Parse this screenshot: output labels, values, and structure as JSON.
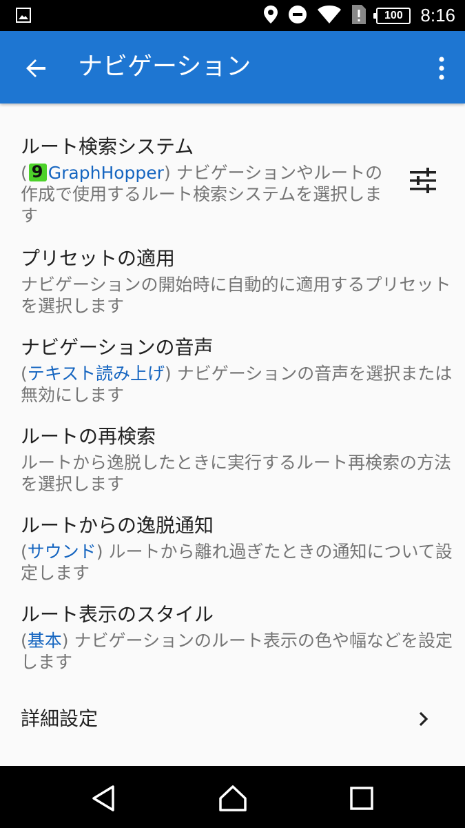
{
  "status_bar": {
    "battery": "100",
    "time": "8:16",
    "icons": [
      "image-icon",
      "location-icon",
      "do-not-disturb-icon",
      "wifi-icon",
      "sim-alert-icon",
      "battery-icon"
    ]
  },
  "app_bar": {
    "title": "ナビゲーション",
    "back_icon": "arrow-left-icon",
    "menu_icon": "more-vert-icon",
    "color": "#1e76d2"
  },
  "prefs": {
    "route_engine": {
      "title": "ルート検索システム",
      "engine": "GraphHopper",
      "summary": "ナビゲーションやルートの作成で使用するルート検索システムを選択します"
    },
    "preset": {
      "title": "プリセットの適用",
      "summary": "ナビゲーションの開始時に自動的に適用するプリセットを選択します"
    },
    "voice": {
      "title": "ナビゲーションの音声",
      "value": "テキスト読み上げ",
      "summary": "ナビゲーションの音声を選択または無効にします"
    },
    "recalc": {
      "title": "ルートの再検索",
      "summary": "ルートから逸脱したときに実行するルート再検索の方法を選択します"
    },
    "deviation": {
      "title": "ルートからの逸脱通知",
      "value": "サウンド",
      "summary": "ルートから離れ過ぎたときの通知について設定します"
    },
    "style": {
      "title": "ルート表示のスタイル",
      "value": "基本",
      "summary": "ナビゲーションのルート表示の色や幅などを設定します"
    },
    "advanced": {
      "title": "詳細設定"
    }
  },
  "colors": {
    "accent": "#1565c0",
    "secondary_text": "#757575",
    "primary_text": "#212121"
  }
}
